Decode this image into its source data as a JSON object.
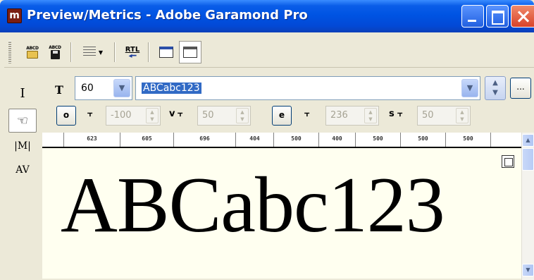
{
  "window": {
    "title": "Preview/Metrics - Adobe Garamond Pro",
    "app_icon_glyph": "m"
  },
  "toolbar": {
    "open_label": "ABCD",
    "save_label": "ABCD",
    "rtl_label": "RTL",
    "icons": [
      "open-file-icon",
      "save-file-icon",
      "line-spacing-icon",
      "rtl-icon",
      "panel-icon",
      "metrics-panel-icon"
    ]
  },
  "palette": {
    "tools": [
      {
        "name": "text-cursor-icon",
        "glyph": "I"
      },
      {
        "name": "hand-icon",
        "glyph": "☜"
      },
      {
        "name": "metrics-tool-icon",
        "glyph": "|M|"
      },
      {
        "name": "kerning-tool-icon",
        "glyph": "AV"
      }
    ]
  },
  "controls": {
    "size_icon": "T",
    "font_size": "60",
    "sample_text": "ABCabc123",
    "more_button": "...",
    "left_metric_button": "o",
    "left_side_value": "-100",
    "left_v_label": "v",
    "left_v_value": "50",
    "right_metric_button": "e",
    "right_side_value": "236",
    "right_s_label": "s",
    "right_s_value": "50"
  },
  "ruler": {
    "values": [
      "623",
      "605",
      "696",
      "404",
      "500",
      "400",
      "500",
      "500",
      "500"
    ]
  },
  "preview": {
    "text": "ABCabc123"
  },
  "colors": {
    "titlebar": "#0054E3",
    "selection": "#316AC5",
    "canvas_bg": "#FFFFF0",
    "window_bg": "#ECE9D8"
  }
}
